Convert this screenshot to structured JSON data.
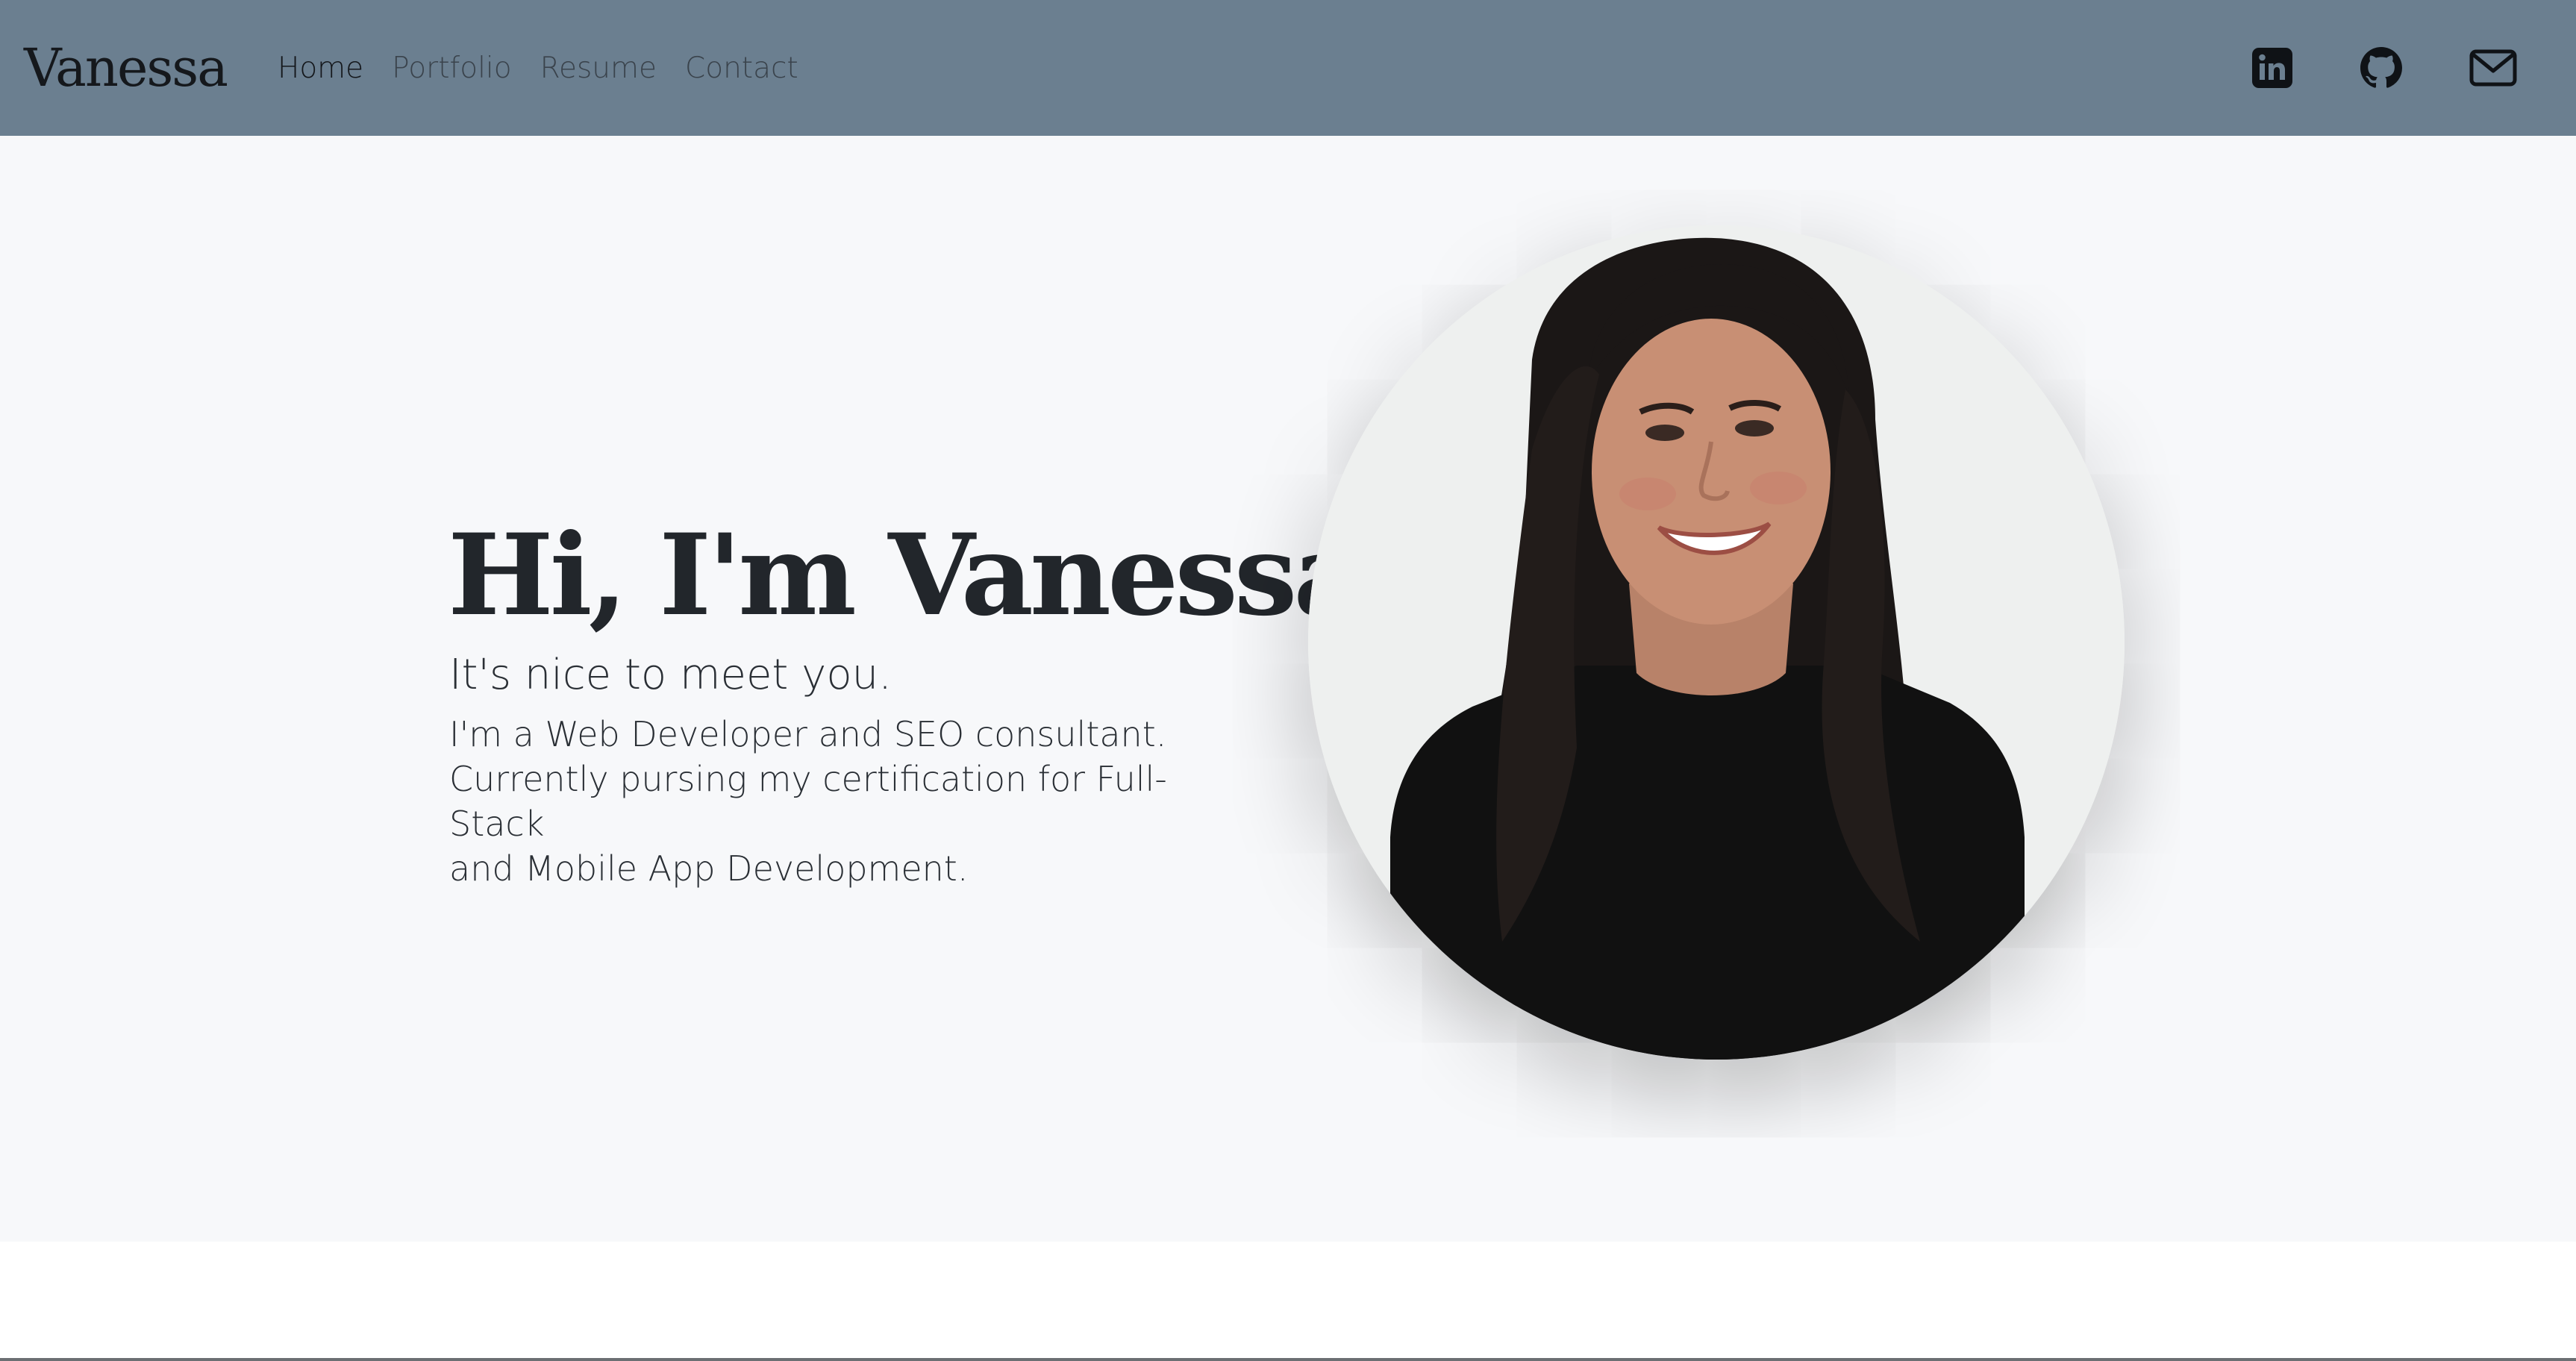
{
  "nav": {
    "brand": "Vanessa",
    "links": [
      {
        "label": "Home",
        "active": true
      },
      {
        "label": "Portfolio",
        "active": false
      },
      {
        "label": "Resume",
        "active": false
      },
      {
        "label": "Contact",
        "active": false
      }
    ],
    "social_icons": [
      "linkedin-icon",
      "github-icon",
      "mail-icon"
    ]
  },
  "hero": {
    "title": "Hi, I'm Vanessa.",
    "subtitle": "It's nice to meet you.",
    "description_lines": [
      "I'm a Web Developer and SEO consultant.",
      "Currently pursing my certification for Full-Stack",
      "and Mobile App Development."
    ]
  },
  "colors": {
    "navbar_bg": "#6b7f90",
    "hero_bg": "#f7f8fa",
    "text_dark": "#22262b"
  }
}
